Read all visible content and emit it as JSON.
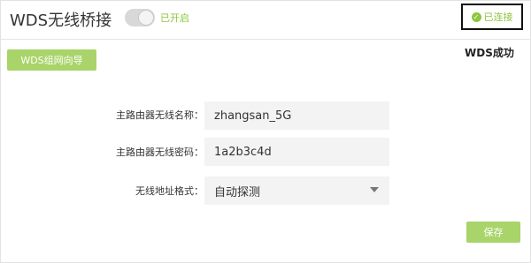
{
  "header": {
    "title": "WDS无线桥接",
    "toggle_label": "已开启",
    "status_label": "已连接",
    "status_icon": "check-circle-icon"
  },
  "toolbar": {
    "wizard_label": "WDS组网向导",
    "result_text": "WDS成功"
  },
  "form": {
    "ssid_label": "主路由器无线名称：",
    "ssid_value": "zhangsan_5G",
    "password_label": "主路由器无线密码：",
    "password_value": "1a2b3c4d",
    "address_label": "无线地址格式：",
    "address_value": "自动探测"
  },
  "footer": {
    "save_label": "保存"
  },
  "colors": {
    "accent_green": "#8dc63f",
    "button_green": "#a8d46a",
    "field_bg": "#f3f3f3"
  }
}
